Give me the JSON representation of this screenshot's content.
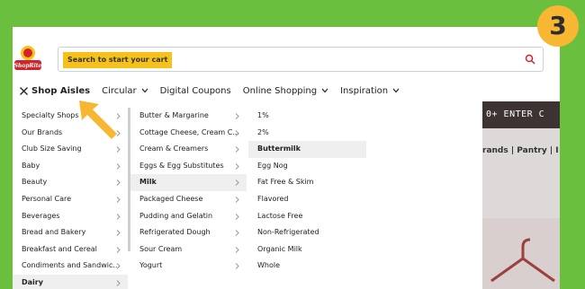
{
  "search": {
    "placeholder": "Search to start your cart"
  },
  "nav": {
    "items": [
      {
        "label": "Shop Aisles"
      },
      {
        "label": "Circular"
      },
      {
        "label": "Digital Coupons"
      },
      {
        "label": "Online Shopping"
      },
      {
        "label": "Inspiration"
      }
    ]
  },
  "aisles": [
    "Specialty Shops",
    "Our Brands",
    "Club Size Saving",
    "Baby",
    "Beauty",
    "Personal Care",
    "Beverages",
    "Bread and Bakery",
    "Breakfast and Cereal",
    "Condiments and Sandwic...",
    "Dairy"
  ],
  "dairy": [
    "Butter & Margarine",
    "Cottage Cheese, Cream C...",
    "Cream & Creamers",
    "Eggs & Egg Substitutes",
    "Milk",
    "Packaged Cheese",
    "Pudding and Gelatin",
    "Refrigerated Dough",
    "Sour Cream",
    "Yogurt"
  ],
  "milk": [
    "1%",
    "2%",
    "Buttermilk",
    "Egg Nog",
    "Fat Free & Skim",
    "Flavored",
    "Lactose Free",
    "Non-Refrigerated",
    "Organic Milk",
    "Whole"
  ],
  "background": {
    "strip": "0+  ENTER C",
    "links": "rands | Pantry | I"
  },
  "badge": "3",
  "colors": {
    "page_bg": "#6abf3f",
    "accent": "#f7b733",
    "highlight": "#f6c21a",
    "search_icon": "#d2232a"
  }
}
